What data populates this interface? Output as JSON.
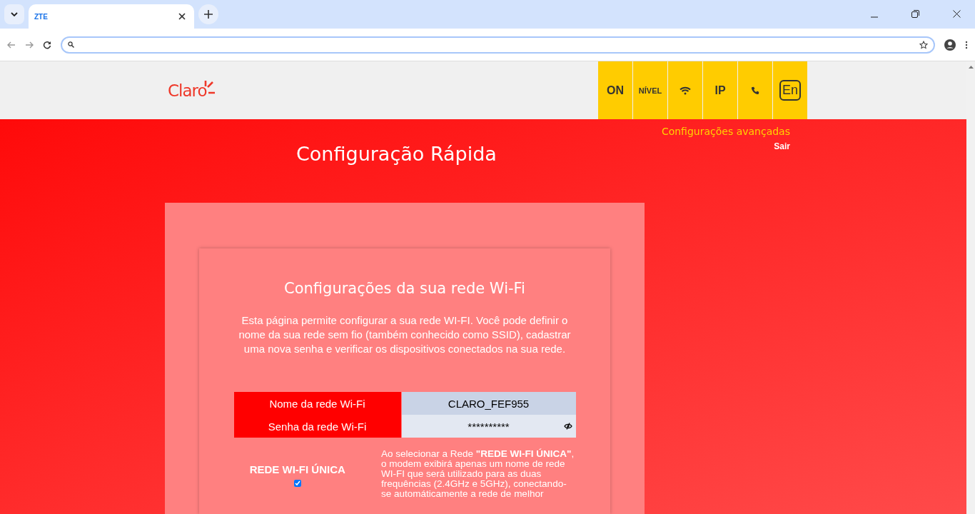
{
  "browser": {
    "tabs": [
      {
        "title": "ZTE",
        "selected": true
      }
    ]
  },
  "header": {
    "logo": "Claro",
    "tiles": [
      {
        "kind": "text",
        "label": "ON"
      },
      {
        "kind": "text",
        "label": "NÍVEL"
      },
      {
        "kind": "wifi"
      },
      {
        "kind": "text",
        "label": "IP"
      },
      {
        "kind": "phone"
      },
      {
        "kind": "language",
        "label": "En"
      }
    ]
  },
  "links": {
    "advanced": "Configurações avançadas",
    "logout": "Sair"
  },
  "page_title": "Configuração Rápida",
  "card": {
    "title": "Configurações da sua rede Wi-Fi",
    "description": "Esta página permite configurar a sua rede WI-FI. Você pode definir o nome da sua rede sem fio (também conhecido como SSID), cadastrar uma nova senha e verificar os dispositivos conectados na sua rede.",
    "fields": [
      {
        "kind": "text",
        "label": "Nome da rede Wi-Fi",
        "value": "CLARO_FEF955"
      },
      {
        "kind": "password",
        "label": "Senha da rede Wi-Fi",
        "value": "**********"
      }
    ],
    "single_network": {
      "label": "REDE WI-FI ÚNICA",
      "checked": true,
      "description": "Ao selecionar a Rede **\"REDE WI-FI ÚNICA\"**, o modem exibirá apenas um nome de rede WI-FI que será utilizado para as duas frequências (2.4GHz e 5GHz), conectando-se automáticamente a rede de melhor"
    }
  }
}
